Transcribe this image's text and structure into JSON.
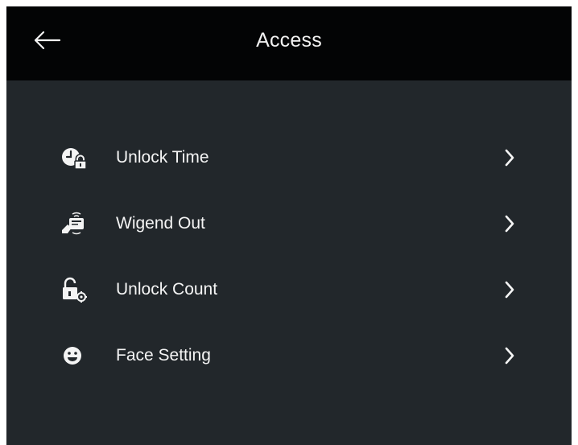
{
  "header": {
    "title": "Access",
    "back_icon": "arrow-left-icon"
  },
  "menu": {
    "items": [
      {
        "label": "Unlock Time",
        "icon": "clock-lock-icon"
      },
      {
        "label": "Wigend Out",
        "icon": "card-reader-icon"
      },
      {
        "label": "Unlock Count",
        "icon": "lock-gear-icon"
      },
      {
        "label": "Face Setting",
        "icon": "face-icon"
      }
    ]
  },
  "colors": {
    "header_background": "#030405",
    "screen_background": "#22272b",
    "text": "#f4f4f4"
  }
}
